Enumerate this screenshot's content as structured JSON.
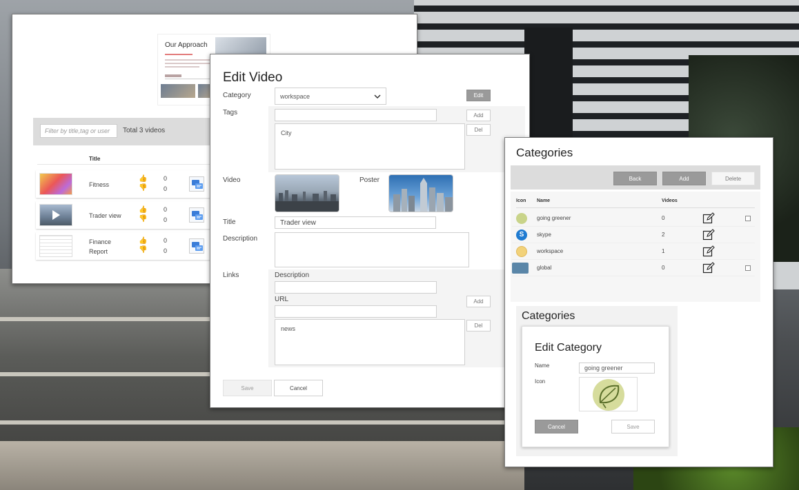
{
  "video_list": {
    "preview": {
      "title": "Our Approach"
    },
    "filter_placeholder": "Filter by title,tag or user",
    "total_text": "Total 3 videos",
    "column_title": "Title",
    "rows": [
      {
        "title": "Fitness",
        "likes": "0",
        "dislikes": "0"
      },
      {
        "title": "Trader view",
        "likes": "0",
        "dislikes": "0"
      },
      {
        "title_line1": "Finance",
        "title_line2": "Report",
        "likes": "0",
        "dislikes": "0"
      }
    ]
  },
  "edit_video": {
    "heading": "Edit Video",
    "category_label": "Category",
    "category_value": "workspace",
    "edit_button": "Edit",
    "tags_label": "Tags",
    "tags_input": "",
    "tags_add": "Add",
    "tags_del": "Del",
    "tags_list": "City",
    "video_label": "Video",
    "poster_label": "Poster",
    "title_label": "Title",
    "title_value": "Trader view",
    "description_label": "Description",
    "description_value": "",
    "links_label": "Links",
    "link_description_label": "Description",
    "link_url_label": "URL",
    "links_add": "Add",
    "links_del": "Del",
    "links_list": "news",
    "save_button": "Save",
    "cancel_button": "Cancel"
  },
  "categories": {
    "heading": "Categories",
    "back_button": "Back",
    "add_button": "Add",
    "delete_button": "Delete",
    "columns": {
      "icon": "Icon",
      "name": "Name",
      "videos": "Videos"
    },
    "rows": [
      {
        "name": "going greener",
        "videos": "0",
        "icon": "leaf-icon",
        "color": "#c9d48a",
        "checkbox": true
      },
      {
        "name": "skype",
        "videos": "2",
        "icon": "skype-icon",
        "color": "#1f7bd1",
        "checkbox": false
      },
      {
        "name": "workspace",
        "videos": "1",
        "icon": "workspace-icon",
        "color": "#f2d27a",
        "checkbox": false
      },
      {
        "name": "global",
        "videos": "0",
        "icon": "globe-icon",
        "color": "#5a86a8",
        "checkbox": true
      }
    ],
    "sub_heading": "Categories",
    "edit_category": {
      "heading": "Edit Category",
      "name_label": "Name",
      "name_value": "going greener",
      "icon_label": "Icon",
      "cancel_button": "Cancel",
      "save_button": "Save"
    }
  }
}
